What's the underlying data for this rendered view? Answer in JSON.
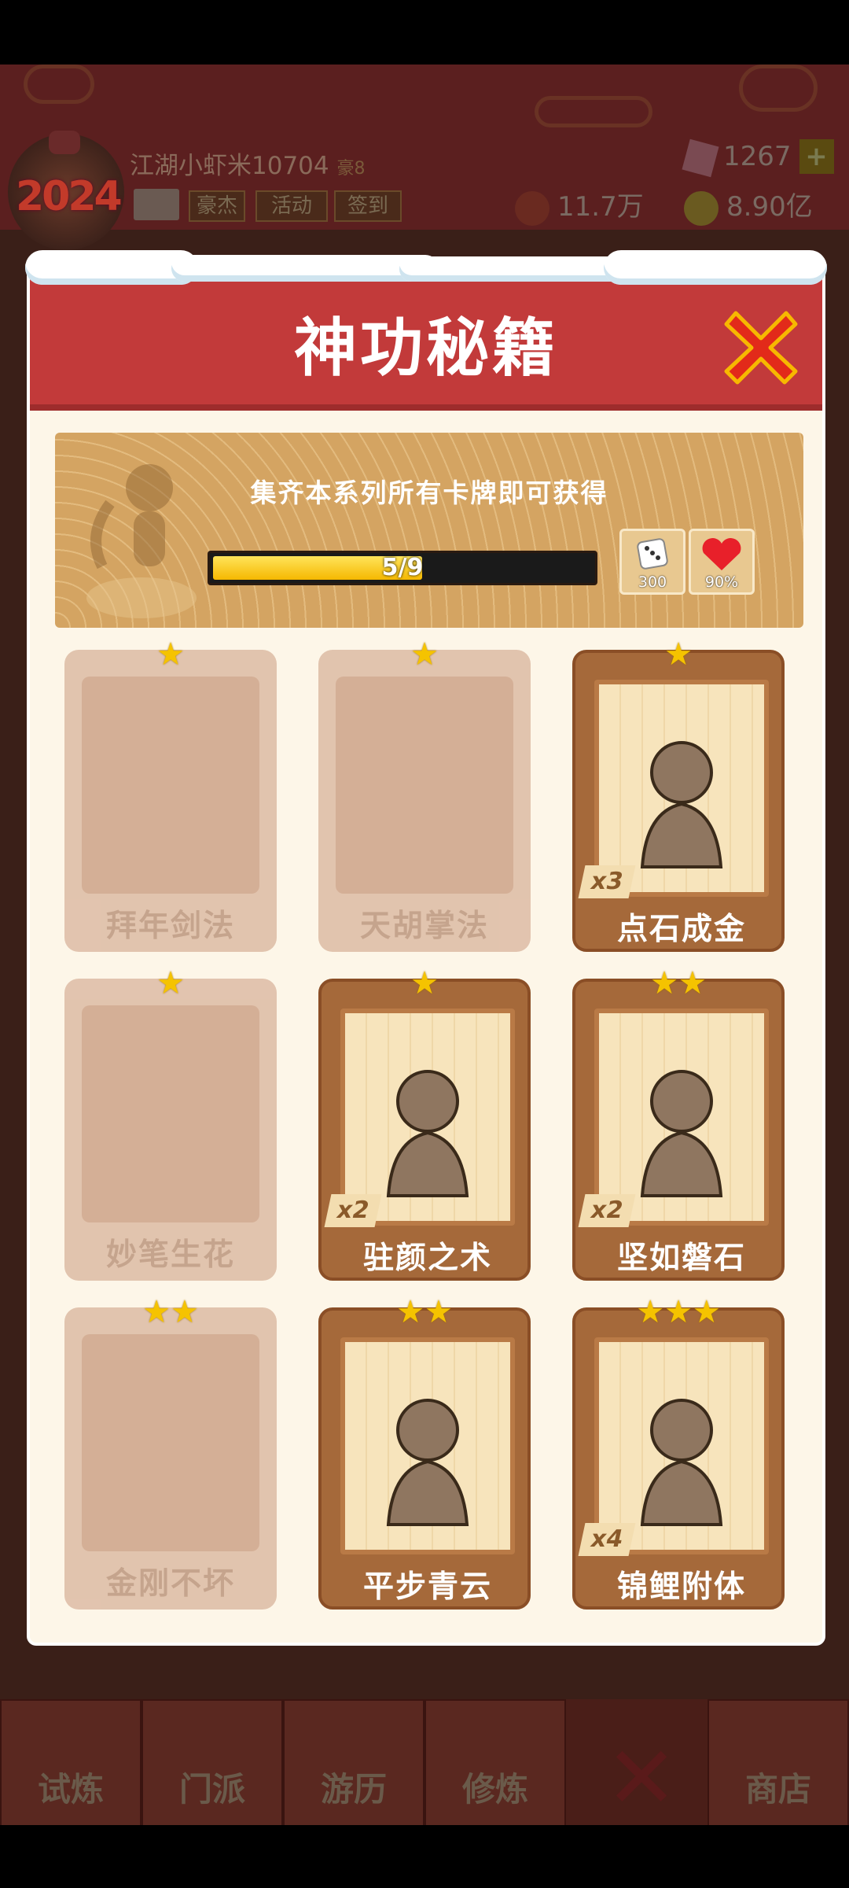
{
  "topbar": {
    "username": "江湖小虾米10704",
    "rank": "豪8",
    "avatar_year": "2024",
    "buttons": [
      "豪杰",
      "活动",
      "签到"
    ],
    "gems": "1267",
    "wealth": "11.7万",
    "coins": "8.90亿"
  },
  "dialog": {
    "title": "神功秘籍",
    "banner_text": "集齐本系列所有卡牌即可获得",
    "progress": {
      "current": 5,
      "total": 9,
      "label": "5/9"
    },
    "rewards": [
      {
        "icon": "dice-icon",
        "value": "300"
      },
      {
        "icon": "heart-icon",
        "value": "90%"
      }
    ]
  },
  "cards": [
    {
      "name": "拜年剑法",
      "stars": "★",
      "owned": false,
      "count": ""
    },
    {
      "name": "天胡掌法",
      "stars": "★",
      "owned": false,
      "count": ""
    },
    {
      "name": "点石成金",
      "stars": "★",
      "owned": true,
      "count": "x3"
    },
    {
      "name": "妙笔生花",
      "stars": "★",
      "owned": false,
      "count": ""
    },
    {
      "name": "驻颜之术",
      "stars": "★",
      "owned": true,
      "count": "x2"
    },
    {
      "name": "坚如磐石",
      "stars": "★★",
      "owned": true,
      "count": "x2"
    },
    {
      "name": "金刚不坏",
      "stars": "★★",
      "owned": false,
      "count": ""
    },
    {
      "name": "平步青云",
      "stars": "★★",
      "owned": true,
      "count": ""
    },
    {
      "name": "锦鲤附体",
      "stars": "★★★",
      "owned": true,
      "count": "x4"
    }
  ],
  "bottom_nav": [
    "试炼",
    "门派",
    "游历",
    "修炼",
    "商店"
  ],
  "colors": {
    "header_red": "#c23a3a",
    "card_brown": "#a5693a",
    "star_gold": "#f5c300"
  }
}
